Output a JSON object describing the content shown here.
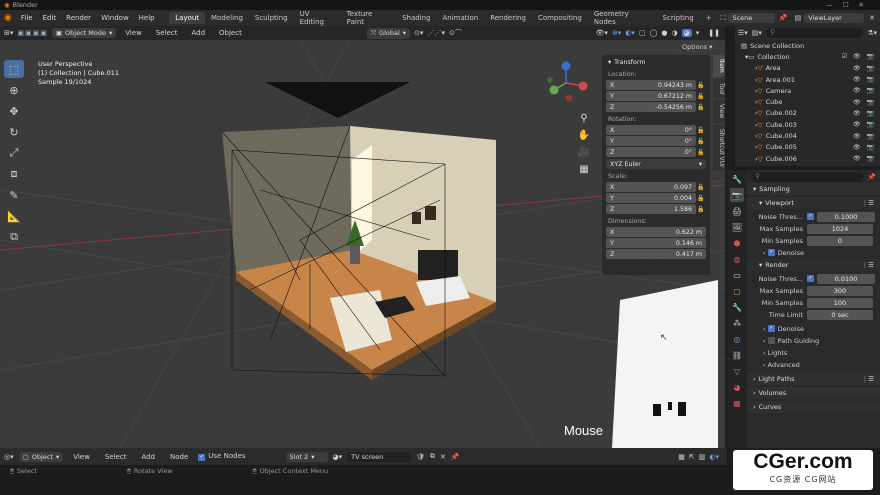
{
  "app_title": "Blender",
  "menu": [
    "File",
    "Edit",
    "Render",
    "Window",
    "Help"
  ],
  "workspaces": [
    "Layout",
    "Modeling",
    "Sculpting",
    "UV Editing",
    "Texture Paint",
    "Shading",
    "Animation",
    "Rendering",
    "Compositing",
    "Geometry Nodes",
    "Scripting"
  ],
  "scene_name": "Scene",
  "view_layer": "ViewLayer",
  "viewport_header": {
    "mode": "Object Mode",
    "menus": [
      "View",
      "Select",
      "Add",
      "Object"
    ],
    "transform_orientation": "Global",
    "options_label": "Options"
  },
  "viewport_info": {
    "line1": "User Perspective",
    "line2": "(1) Collection | Cube.011",
    "line3": "Sample 19/1024"
  },
  "npanel": {
    "header": "Transform",
    "location_label": "Location:",
    "location": [
      {
        "axis": "X",
        "value": "0.94243 m"
      },
      {
        "axis": "Y",
        "value": "0.67212 m"
      },
      {
        "axis": "Z",
        "value": "-0.54256 m"
      }
    ],
    "rotation_label": "Rotation:",
    "rotation": [
      {
        "axis": "X",
        "value": "0°"
      },
      {
        "axis": "Y",
        "value": "0°"
      },
      {
        "axis": "Z",
        "value": "0°"
      }
    ],
    "rotation_mode": "XYZ Euler",
    "scale_label": "Scale:",
    "scale": [
      {
        "axis": "X",
        "value": "0.097"
      },
      {
        "axis": "Y",
        "value": "0.004"
      },
      {
        "axis": "Z",
        "value": "1.586"
      }
    ],
    "dimensions_label": "Dimensions:",
    "dimensions": [
      {
        "axis": "X",
        "value": "0.622 m"
      },
      {
        "axis": "Y",
        "value": "0.146 m"
      },
      {
        "axis": "Z",
        "value": "0.417 m"
      }
    ],
    "tabs": [
      "Item",
      "Tool",
      "View",
      "Shortcut VUr"
    ]
  },
  "outliner": {
    "root": "Scene Collection",
    "collection": "Collection",
    "items": [
      {
        "name": "Area",
        "color": "#e38b3a"
      },
      {
        "name": "Area.001",
        "color": "#e38b3a"
      },
      {
        "name": "Camera",
        "color": "#e38b3a"
      },
      {
        "name": "Cube",
        "color": "#e38b3a"
      },
      {
        "name": "Cube.002",
        "color": "#e38b3a"
      },
      {
        "name": "Cube.003",
        "color": "#e38b3a"
      },
      {
        "name": "Cube.004",
        "color": "#e38b3a"
      },
      {
        "name": "Cube.005",
        "color": "#e38b3a"
      },
      {
        "name": "Cube.006",
        "color": "#e38b3a"
      }
    ]
  },
  "properties": {
    "sampling": "Sampling",
    "viewport": "Viewport",
    "vp_noise_label": "Noise Thres...",
    "vp_noise": "0.1000",
    "vp_max_label": "Max Samples",
    "vp_max": "1024",
    "vp_min_label": "Min Samples",
    "vp_min": "0",
    "denoise1": "Denoise",
    "render": "Render",
    "r_noise_label": "Noise Thres...",
    "r_noise": "0.0100",
    "r_max_label": "Max Samples",
    "r_max": "300",
    "r_min_label": "Min Samples",
    "r_min": "100",
    "time_label": "Time Limit",
    "time": "0 sec",
    "denoise2": "Denoise",
    "path_guiding": "Path Guiding",
    "lights": "Lights",
    "advanced": "Advanced",
    "light_paths": "Light Paths",
    "volumes": "Volumes",
    "curves": "Curves"
  },
  "shader_header": {
    "object": "Object",
    "menus": [
      "View",
      "Select",
      "Add",
      "Node"
    ],
    "use_nodes": "Use Nodes",
    "slot": "Slot 2",
    "material": "TV screen"
  },
  "status": {
    "select": "Select",
    "rotate": "Rotate View",
    "context": "Object Context Menu"
  },
  "overlay_text": "Mouse",
  "watermark": {
    "main": "CGer.com",
    "sub": "CG资源 CG网站"
  },
  "colors": {
    "accent": "#4a77c4",
    "object_icon": "#e38b3a",
    "viewport_bg": "#3b3b3b"
  }
}
